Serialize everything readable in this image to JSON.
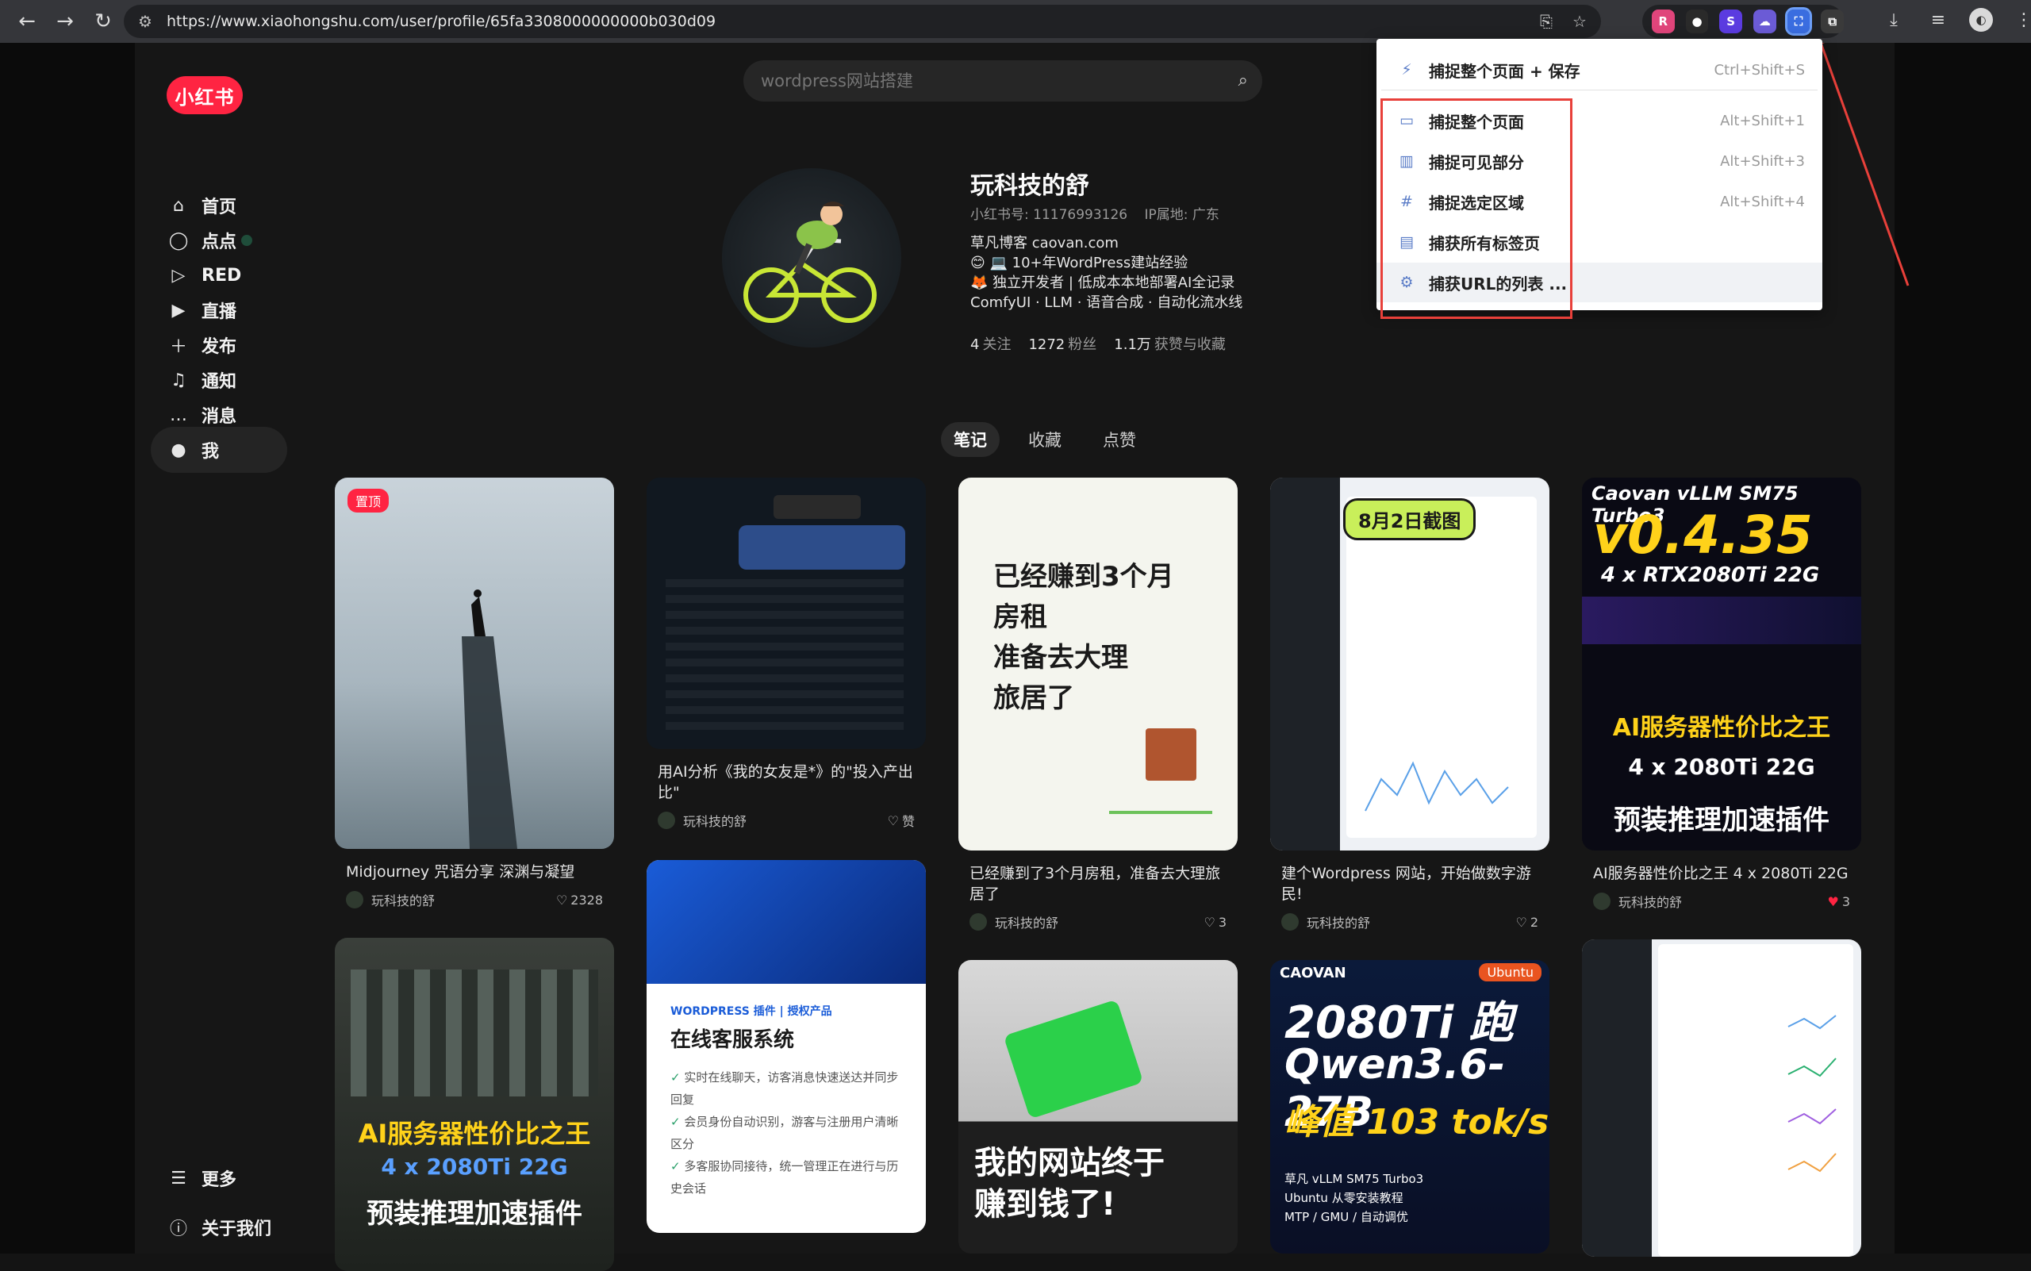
{
  "browser": {
    "url": "https://www.xiaohongshu.com/user/profile/65fa3308000000000b030d09",
    "extensions": [
      {
        "name": "ext-red-icon",
        "label": "R",
        "color": "#e0457b"
      },
      {
        "name": "ext-dot-icon",
        "label": "●",
        "color": "#2a2a2a"
      },
      {
        "name": "ext-s-icon",
        "label": "S",
        "color": "#5b3be0"
      },
      {
        "name": "ext-cloud-icon",
        "label": "☁",
        "color": "#6b5bd6"
      },
      {
        "name": "ext-capture-icon",
        "label": "⛶",
        "color": "#3a6de0"
      },
      {
        "name": "ext-puzzle-icon",
        "label": "⧉",
        "color": "#3a3a3a"
      }
    ]
  },
  "sidebar": {
    "logo": "小红书",
    "items": [
      {
        "label": "首页",
        "icon": "home-icon",
        "glyph": "⌂"
      },
      {
        "label": "点点",
        "icon": "chat-bubble-icon",
        "glyph": "◯"
      },
      {
        "label": "RED",
        "icon": "play-circle-icon",
        "glyph": "▷"
      },
      {
        "label": "直播",
        "icon": "live-icon",
        "glyph": "▶"
      },
      {
        "label": "发布",
        "icon": "plus-square-icon",
        "glyph": "＋"
      },
      {
        "label": "通知",
        "icon": "bell-icon",
        "glyph": "♫"
      },
      {
        "label": "消息",
        "icon": "message-icon",
        "glyph": "…"
      },
      {
        "label": "我",
        "icon": "me-avatar-icon",
        "glyph": "●"
      }
    ],
    "bottom": [
      {
        "label": "更多",
        "icon": "menu-icon",
        "glyph": "☰"
      },
      {
        "label": "关于我们",
        "icon": "info-icon",
        "glyph": "ⓘ"
      }
    ]
  },
  "search": {
    "placeholder": "wordpress网站搭建"
  },
  "profile": {
    "name": "玩科技的舒",
    "id_label": "小红书号: 11176993126",
    "ip_label": "IP属地: 广东",
    "bio": [
      "草凡博客 caovan.com",
      "😊 💻 10+年WordPress建站经验",
      "🦊 独立开发者 | 低成本本地部署AI全记录",
      "ComfyUI · LLM · 语音合成 · 自动化流水线"
    ],
    "stats": [
      {
        "value": "4",
        "label": "关注"
      },
      {
        "value": "1272",
        "label": "粉丝"
      },
      {
        "value": "1.1万",
        "label": "获赞与收藏"
      }
    ]
  },
  "tabs": [
    "笔记",
    "收藏",
    "点赞"
  ],
  "cards": [
    {
      "title": "Midjourney 咒语分享 深渊与凝望",
      "author": "玩科技的舒",
      "likes": "2328",
      "pin": "置顶",
      "liked": false
    },
    {
      "title": "用AI分析《我的女友是*》的\"投入产出比\"",
      "author": "玩科技的舒",
      "likes": "赞",
      "liked": false
    },
    {
      "title": "已经赚到了3个月房租，准备去大理旅居了",
      "author": "玩科技的舒",
      "likes": "3",
      "liked": false,
      "image_text": [
        "已经赚到3个月",
        "房租",
        "准备去大理",
        "旅居了"
      ]
    },
    {
      "title": "建个Wordpress 网站，开始做数字游民!",
      "author": "玩科技的舒",
      "likes": "2",
      "liked": false,
      "image_text": [
        "8月2日截图"
      ]
    },
    {
      "title": "AI服务器性价比之王 4 x 2080Ti 22G",
      "author": "玩科技的舒",
      "likes": "3",
      "liked": true,
      "image_text": [
        "Caovan vLLM SM75 Turbo3",
        "v0.4.35",
        "4 x RTX2080Ti 22G",
        "AI服务器性价比之王",
        "4 x 2080Ti 22G",
        "预装推理加速插件"
      ]
    },
    {
      "image_text": [
        "AI服务器性价比之王",
        "4 x 2080Ti 22G",
        "预装推理加速插件"
      ]
    },
    {
      "image_text": [
        "WORDPRESS 插件 | 授权产品",
        "在线客服系统",
        "实时在线聊天，访客消息快速送达并同步回复",
        "会员身份自动识别，游客与注册用户清晰区分",
        "多客服协同接待，统一管理正在进行与历史会话"
      ]
    },
    {
      "image_text": [
        "我的网站终于",
        "赚到钱了!"
      ]
    },
    {
      "image_text": [
        "CAOVAN",
        "Ubuntu",
        "2080Ti 跑",
        "Qwen3.6-27B",
        "峰值 103 tok/s",
        "草凡 vLLM SM75 Turbo3",
        "Ubuntu 从零安装教程",
        "MTP / GMU / 自动调优"
      ]
    },
    {
      "image_text": []
    }
  ],
  "capture_menu": {
    "items": [
      {
        "label": "捕捉整个页面 + 保存",
        "shortcut": "Ctrl+Shift+S",
        "icon": "lightning-icon",
        "glyph": "⚡"
      },
      {
        "label": "捕捉整个页面",
        "shortcut": "Alt+Shift+1",
        "icon": "full-page-icon",
        "glyph": "▭"
      },
      {
        "label": "捕捉可见部分",
        "shortcut": "Alt+Shift+3",
        "icon": "visible-area-icon",
        "glyph": "▥"
      },
      {
        "label": "捕捉选定区域",
        "shortcut": "Alt+Shift+4",
        "icon": "selection-icon",
        "glyph": "#"
      },
      {
        "label": "捕获所有标签页",
        "shortcut": "",
        "icon": "all-tabs-icon",
        "glyph": "▤"
      },
      {
        "label": "捕获URL的列表 ...",
        "shortcut": "",
        "icon": "url-list-icon",
        "glyph": "⚙"
      }
    ]
  },
  "colors": {
    "brand": "#ff2442",
    "annotation": "#e8403a",
    "menu_icon": "#5a7cc7"
  }
}
